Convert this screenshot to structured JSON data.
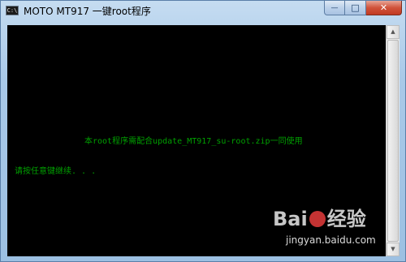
{
  "window": {
    "title": "MOTO MT917  一键root程序",
    "app_icon_text": "C:\\"
  },
  "controls": {
    "minimize": "—",
    "maximize": "□",
    "close": "✕"
  },
  "console": {
    "line1": "本root程序需配合update_MT917_su-root.zip一同使用",
    "line2": "请按任意键继续. . ."
  },
  "watermark": {
    "logo_left": "Bai",
    "logo_right": "经验",
    "url": "jingyan.baidu.com"
  },
  "colors": {
    "console_bg": "#000000",
    "console_text": "#00a000",
    "titlebar": "#a9c9e8",
    "close_button": "#c23a22"
  }
}
